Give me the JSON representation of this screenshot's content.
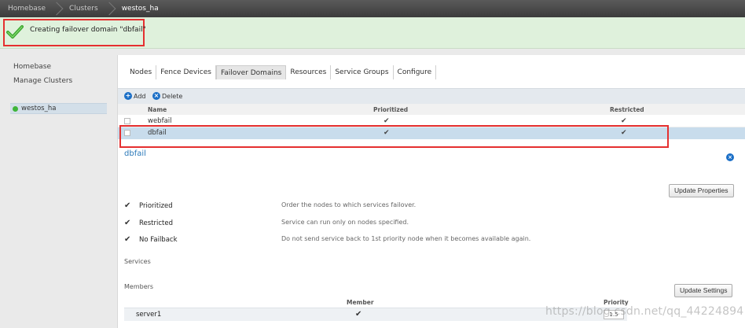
{
  "breadcrumb": [
    "Homebase",
    "Clusters",
    "westos_ha"
  ],
  "notification": {
    "message": "Creating failover domain \"dbfail\""
  },
  "sidebar": {
    "links": [
      "Homebase",
      "Manage Clusters"
    ],
    "cluster": "westos_ha"
  },
  "tabs": [
    "Nodes",
    "Fence Devices",
    "Failover Domains",
    "Resources",
    "Service Groups",
    "Configure"
  ],
  "active_tab": "Failover Domains",
  "toolbar": {
    "add_label": "Add",
    "delete_label": "Delete"
  },
  "table": {
    "columns": [
      "Name",
      "Prioritized",
      "Restricted"
    ],
    "rows": [
      {
        "name": "webfail",
        "prioritized": "✔",
        "restricted": "✔"
      },
      {
        "name": "dbfail",
        "prioritized": "✔",
        "restricted": "✔"
      }
    ]
  },
  "detail": {
    "title": "dbfail",
    "update_properties_label": "Update Properties",
    "options": [
      {
        "label": "Prioritized",
        "desc": "Order the nodes to which services failover.",
        "checked": "✔"
      },
      {
        "label": "Restricted",
        "desc": "Service can run only on nodes specified.",
        "checked": "✔"
      },
      {
        "label": "No Failback",
        "desc": "Do not send service back to 1st priority node when it becomes available again.",
        "checked": "✔"
      }
    ],
    "services_label": "Services",
    "members_label": "Members",
    "update_settings_label": "Update Settings",
    "member_columns": [
      "Member",
      "Priority"
    ],
    "members": [
      {
        "name": "server1",
        "member": "✔",
        "priority": "1.5"
      }
    ]
  },
  "watermark": "https://blog.csdn.net/qq_44224894"
}
